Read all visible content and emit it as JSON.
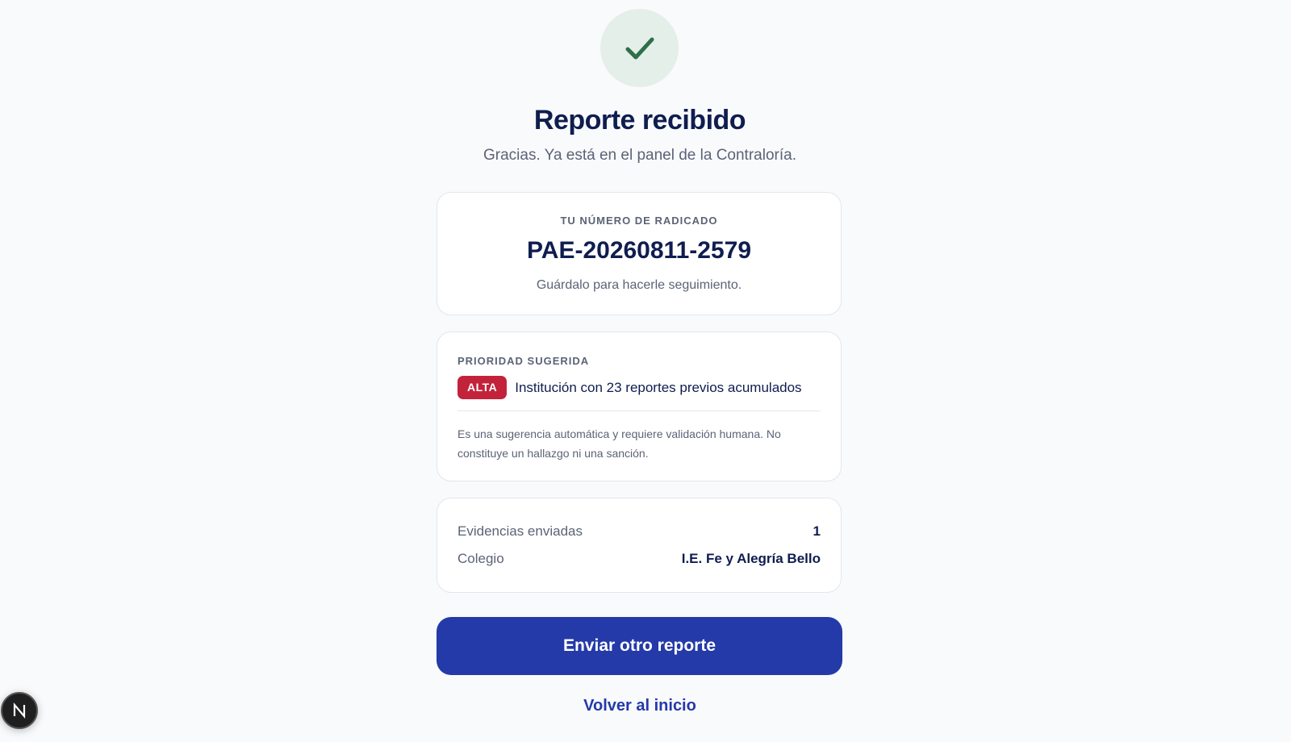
{
  "header": {
    "success_icon": "check-icon",
    "title": "Reporte recibido",
    "subtitle": "Gracias. Ya está en el panel de la Contraloría."
  },
  "radicado": {
    "label": "TU NÚMERO DE RADICADO",
    "number": "PAE-20260811-2579",
    "hint": "Guárdalo para hacerle seguimiento."
  },
  "priority": {
    "label": "PRIORIDAD SUGERIDA",
    "badge": "ALTA",
    "badge_color": "#c3233a",
    "reason": "Institución con 23 reportes previos acumulados",
    "disclaimer": "Es una sugerencia automática y requiere validación humana. No constituye un hallazgo ni una sanción."
  },
  "details": [
    {
      "key": "Evidencias enviadas",
      "value": "1"
    },
    {
      "key": "Colegio",
      "value": "I.E. Fe y Alegría Bello"
    }
  ],
  "actions": {
    "primary_label": "Enviar otro reporte",
    "primary_color": "#243aa8",
    "secondary_label": "Volver al inicio"
  },
  "dev_badge": {
    "icon": "nextjs-icon"
  }
}
